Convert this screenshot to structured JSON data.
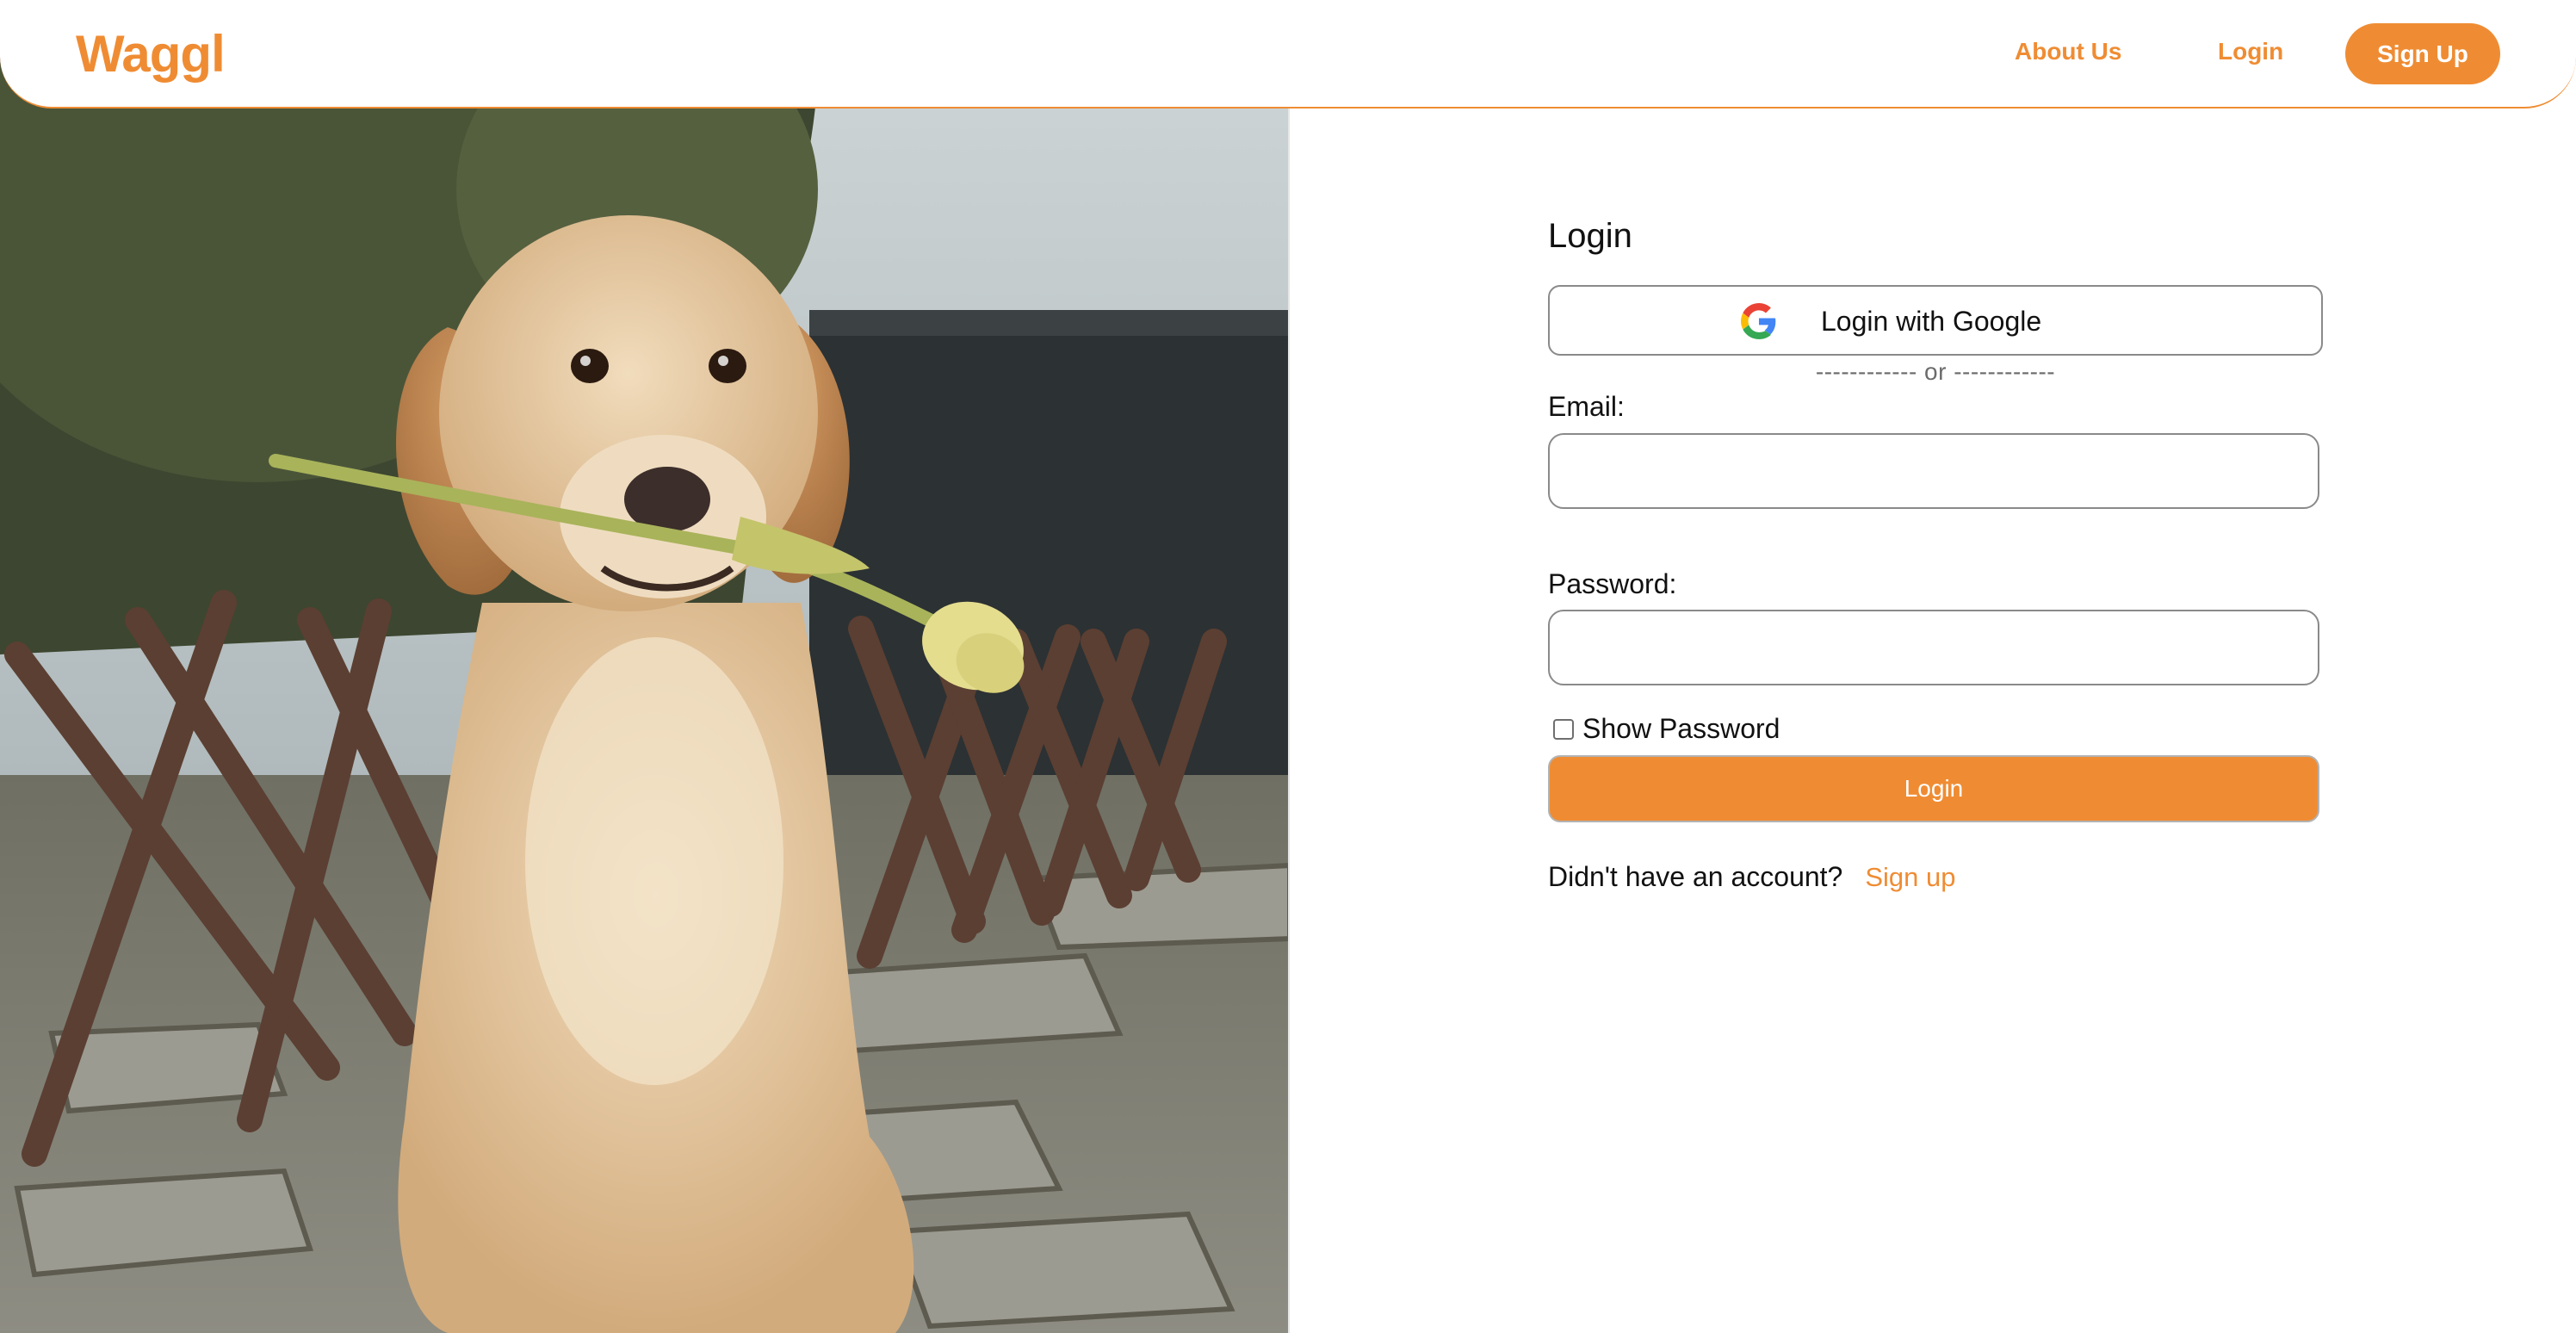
{
  "header": {
    "brand": "Waggl",
    "nav": {
      "about": "About Us",
      "login": "Login",
      "signup": "Sign Up"
    }
  },
  "hero_photo": {
    "subject": "golden puppy holding a yellow tulip in its mouth"
  },
  "login": {
    "title": "Login",
    "google_button": "Login with Google",
    "separator": "------------ or ------------",
    "email_label": "Email:",
    "email_value": "",
    "password_label": "Password:",
    "password_value": "",
    "show_password_label": "Show Password",
    "show_password_checked": false,
    "submit_label": "Login",
    "signup_prompt": "Didn't have an account?",
    "signup_link": "Sign up"
  },
  "colors": {
    "accent": "#ef8c33",
    "input_border": "#8a8a8a"
  },
  "icons": {
    "google": "google-g-icon"
  }
}
